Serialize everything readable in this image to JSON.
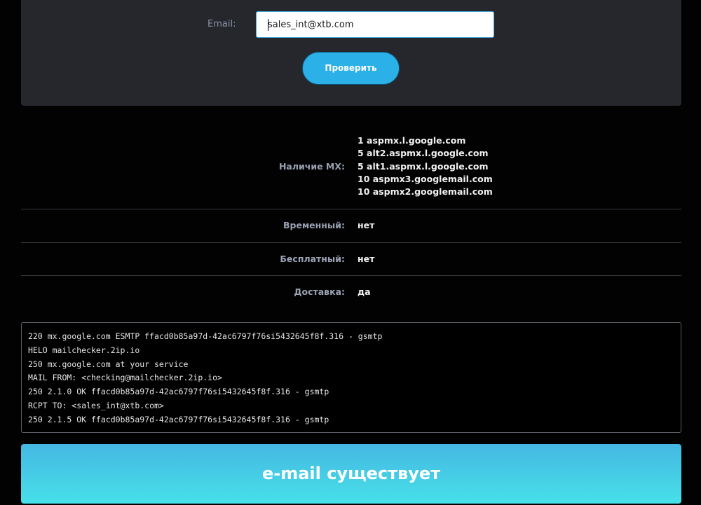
{
  "form": {
    "email_label": "Email:",
    "email_value": "sales_int@xtb.com",
    "check_button_label": "Проверить"
  },
  "results": {
    "mx": {
      "label": "Наличие MX:",
      "records": [
        "1 aspmx.l.google.com",
        "5 alt2.aspmx.l.google.com",
        "5 alt1.aspmx.l.google.com",
        "10 aspmx3.googlemail.com",
        "10 aspmx2.googlemail.com"
      ]
    },
    "temporary": {
      "label": "Временный:",
      "value": "нет"
    },
    "free": {
      "label": "Бесплатный:",
      "value": "нет"
    },
    "delivery": {
      "label": "Доставка:",
      "value": "да"
    }
  },
  "smtp_log": [
    "220 mx.google.com ESMTP ffacd0b85a97d-42ac6797f76si5432645f8f.316 - gsmtp",
    "HELO mailchecker.2ip.io",
    "250 mx.google.com at your service",
    "MAIL FROM: <checking@mailchecker.2ip.io>",
    "250 2.1.0 OK ffacd0b85a97d-42ac6797f76si5432645f8f.316 - gsmtp",
    "RCPT TO: <sales_int@xtb.com>",
    "250 2.1.5 OK ffacd0b85a97d-42ac6797f76si5432645f8f.316 - gsmtp"
  ],
  "result_banner": "e-mail существует",
  "colors": {
    "panel_bg": "#25272d",
    "accent": "#2bb1e8",
    "banner_gradient_top": "#45b8e3",
    "banner_gradient_bottom": "#46e0e8"
  }
}
